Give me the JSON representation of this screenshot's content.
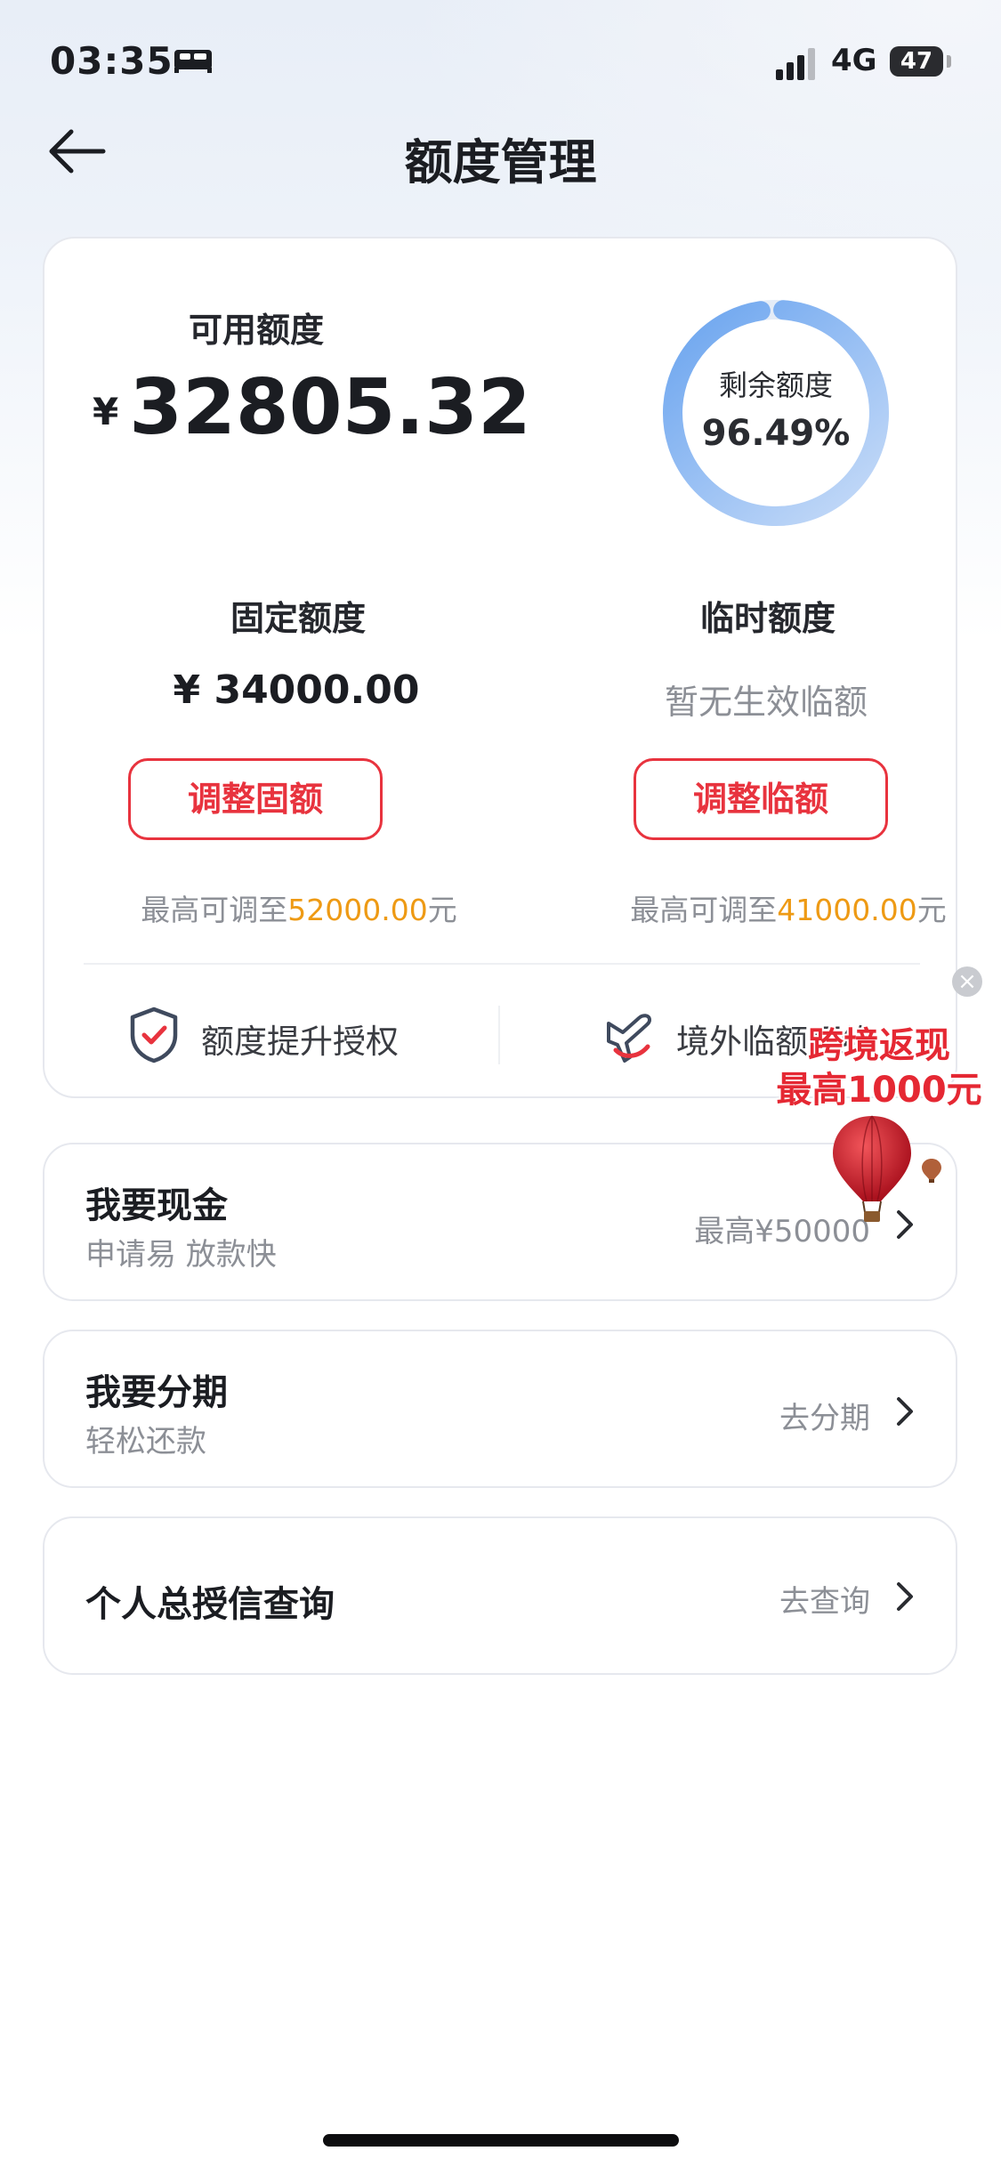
{
  "status_bar": {
    "time": "03:35",
    "network": "4G",
    "battery": "47"
  },
  "header": {
    "title": "额度管理"
  },
  "credit_card": {
    "available_label": "可用额度",
    "currency_symbol": "¥",
    "available_amount": "32805.32",
    "ring_label": "剩余额度",
    "ring_value": "96.49%",
    "ring_percent": 96.49,
    "fixed_title": "固定额度",
    "fixed_amount": "¥ 34000.00",
    "temp_title": "临时额度",
    "temp_status": "暂无生效临额",
    "adjust_fixed_label": "调整固额",
    "adjust_temp_label": "调整临额",
    "max_prefix": "最高可调至",
    "fixed_max": "52000.00",
    "temp_max": "41000.00",
    "max_suffix": "元",
    "features": [
      {
        "label": "额度提升授权",
        "icon": "shield-check-icon"
      },
      {
        "label": "境外临额预约",
        "icon": "airplane-icon"
      }
    ]
  },
  "promo": {
    "line1": "跨境返现",
    "line2": "最高1000元"
  },
  "rows": [
    {
      "title": "我要现金",
      "subtitle": "申请易 放款快",
      "right": "最高¥50000"
    },
    {
      "title": "我要分期",
      "subtitle": "轻松还款",
      "right": "去分期"
    },
    {
      "title": "个人总授信查询",
      "subtitle": "",
      "right": "去查询"
    }
  ],
  "colors": {
    "accent_red": "#e8333e",
    "highlight_orange": "#ee9a14",
    "ring_blue": "#7fb0f2"
  }
}
